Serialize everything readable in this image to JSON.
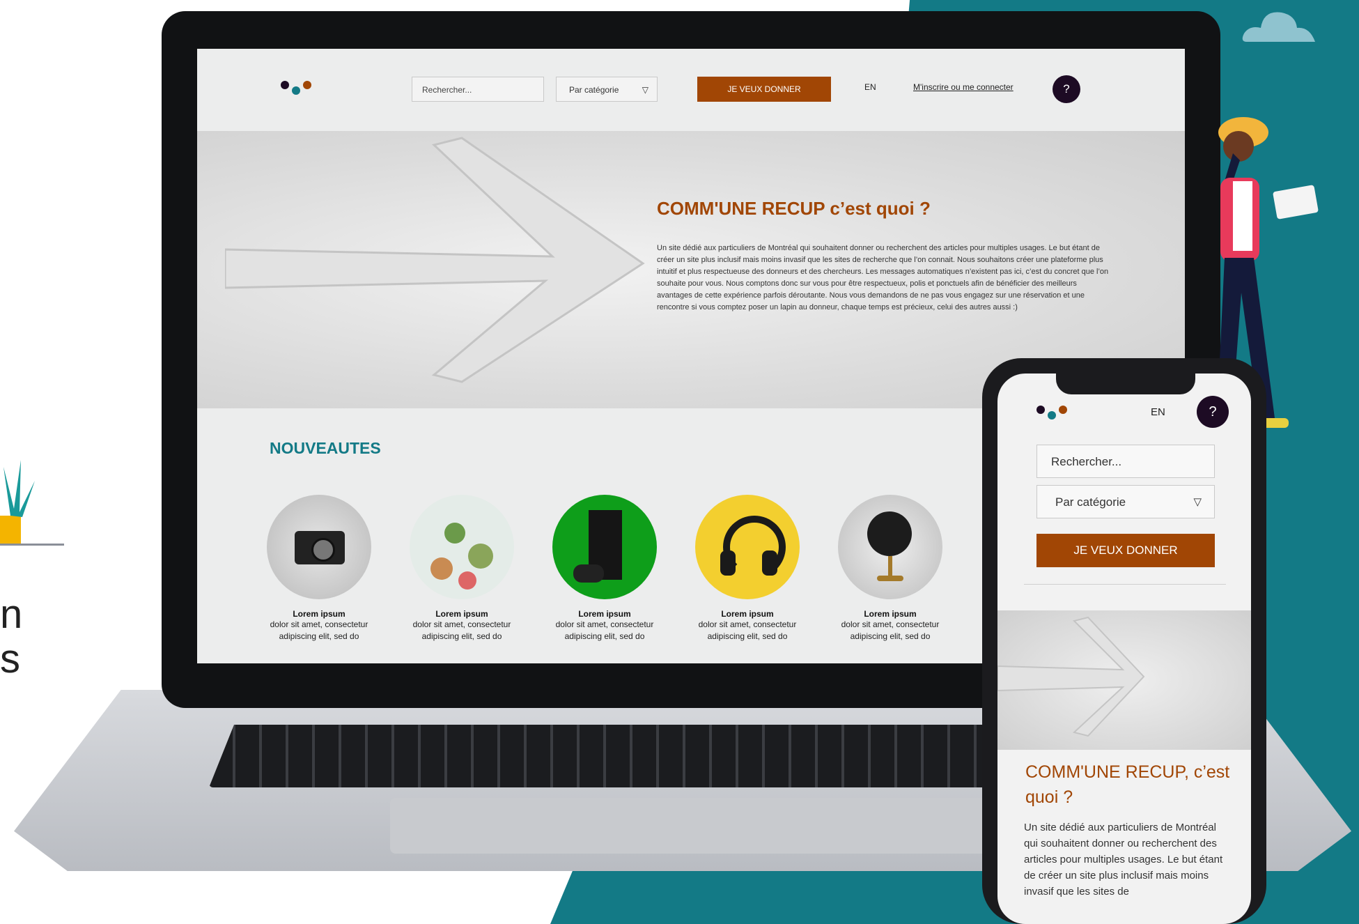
{
  "left_deco": {
    "line1": "n",
    "line2": "s"
  },
  "desktop": {
    "header": {
      "search_placeholder": "Rechercher...",
      "category_label": "Par catégorie",
      "caret": "▽",
      "donate_label": "JE VEUX DONNER",
      "lang": "EN",
      "signin_label": "M'inscrire ou me connecter",
      "help_label": "?"
    },
    "hero": {
      "title": "COMM'UNE RECUP c’est quoi ?",
      "text": "Un site dédié aux particuliers de Montréal qui souhaitent donner ou recherchent des articles pour multiples usages. Le but étant de créer un site plus inclusif mais moins invasif que les sites de recherche que l’on connait. Nous souhaitons créer une plateforme plus intuitif et plus respectueuse des donneurs et des chercheurs. Les messages automatiques n’existent pas ici, c’est du concret que l’on souhaite pour vous. Nous comptons donc sur vous pour être respectueux, polis et ponctuels afin de bénéficier des meilleurs avantages de cette expérience parfois déroutante. Nous vous demandons de ne pas vous engagez sur une réservation et une rencontre si vous comptez poser un lapin au donneur, chaque temps est précieux, celui des autres aussi :)"
    },
    "news_title": "NOUVEAUTES",
    "products": [
      {
        "name": "Lorem ipsum",
        "line1": "dolor sit amet, consectetur",
        "line2": "adipiscing elit, sed do"
      },
      {
        "name": "Lorem ipsum",
        "line1": "dolor sit amet, consectetur",
        "line2": "adipiscing elit, sed do"
      },
      {
        "name": "Lorem ipsum",
        "line1": "dolor sit amet, consectetur",
        "line2": "adipiscing elit, sed do"
      },
      {
        "name": "Lorem ipsum",
        "line1": "dolor sit amet, consectetur",
        "line2": "adipiscing elit, sed do"
      },
      {
        "name": "Lorem ipsum",
        "line1": "dolor sit amet, consectetur",
        "line2": "adipiscing elit, sed do"
      }
    ]
  },
  "mobile": {
    "lang": "EN",
    "help_label": "?",
    "search_placeholder": "Rechercher...",
    "category_label": "Par catégorie",
    "caret": "▽",
    "donate_label": "JE VEUX DONNER",
    "hero_title": "COMM'UNE RECUP, c’est quoi ?",
    "hero_text": "Un site dédié aux particuliers de Montréal qui souhaitent donner ou recherchent des articles pour multiples usages. Le but étant de créer un site plus inclusif mais moins invasif que les sites de"
  },
  "colors": {
    "brand_orange": "#a14605",
    "brand_teal": "#137a86",
    "help_bg": "#1d0b24",
    "dot_dark": "#1d0b24",
    "dot_teal": "#137a86",
    "dot_orange": "#a14605"
  },
  "icons": [
    "logo-dots-icon",
    "help-icon",
    "caret-down-icon",
    "camera-image",
    "succulents-image",
    "console-image",
    "headphones-image",
    "globe-image",
    "cloud-icon",
    "plant-icon"
  ]
}
